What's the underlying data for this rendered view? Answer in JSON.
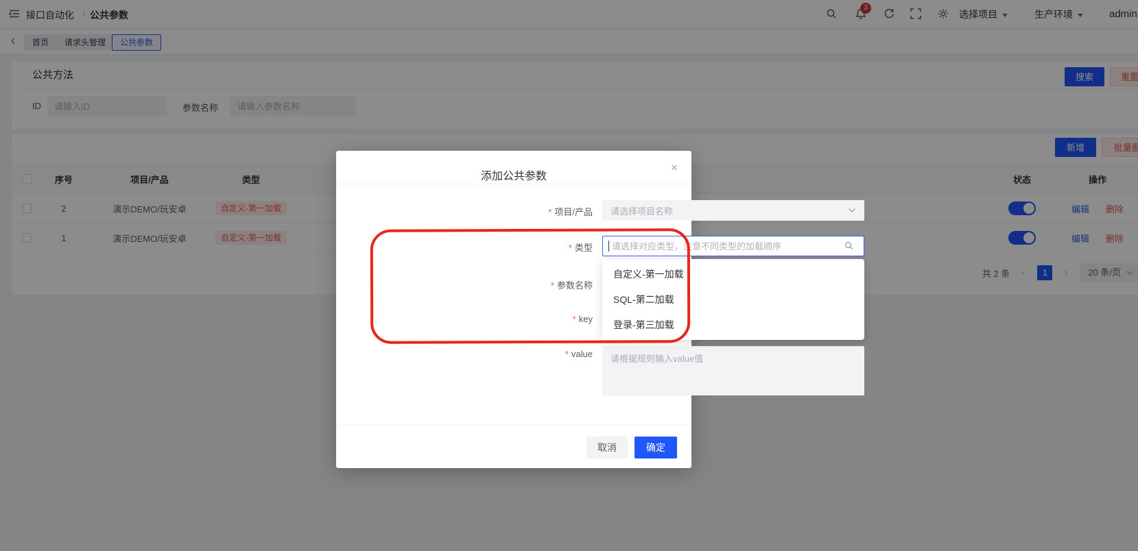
{
  "header": {
    "breadcrumb_root": "接口自动化",
    "breadcrumb_sep": "/",
    "breadcrumb_current": "公共参数",
    "notification_count": "3",
    "project_dropdown": "选择项目",
    "env_dropdown": "生产环境",
    "username": "admin"
  },
  "tabbar": {
    "back_icon": "‹",
    "tabs": [
      {
        "label": "首页"
      },
      {
        "label": "请求头管理"
      },
      {
        "label": "公共参数"
      }
    ]
  },
  "search_panel": {
    "title": "公共方法",
    "id_label": "ID",
    "id_placeholder": "请输入ID",
    "name_label": "参数名称",
    "name_placeholder": "请输入参数名称",
    "search_button": "搜索",
    "reset_button": "重置"
  },
  "toolbar": {
    "add_button": "新增",
    "batch_delete_button": "批量删除"
  },
  "table": {
    "columns": [
      "序号",
      "项目/产品",
      "类型",
      "状态",
      "操作"
    ],
    "rows": [
      {
        "seq": "2",
        "project": "演示DEMO/玩安卓",
        "type_tag": "自定义-第一加载",
        "status": "on",
        "edit": "编辑",
        "remove": "删除"
      },
      {
        "seq": "1",
        "project": "演示DEMO/玩安卓",
        "type_tag": "自定义-第一加载",
        "status": "on",
        "edit": "编辑",
        "remove": "删除"
      }
    ]
  },
  "pagination": {
    "total": "共 2 条",
    "prev_icon": "‹",
    "page": "1",
    "next_icon": "›",
    "page_size": "20 条/页"
  },
  "modal": {
    "title": "添加公共参数",
    "close_icon": "×",
    "required_mark": "*",
    "project_label": "项目/产品",
    "project_placeholder": "请选择项目名称",
    "type_label": "类型",
    "type_placeholder": "请选择对应类型，注意不同类型的加载顺序",
    "dropdown_options": [
      "自定义-第一加载",
      "SQL-第二加载",
      "登录-第三加载"
    ],
    "param_name_label": "参数名称",
    "key_label": "key",
    "value_label": "value",
    "value_placeholder": "请根据规则输入value值",
    "cancel_button": "取消",
    "ok_button": "确定"
  },
  "colors": {
    "primary": "#2057fa",
    "danger": "#e25656",
    "tag_bg": "#fdebeb",
    "annotation": "#e8271b",
    "mask": "rgba(0,0,0,0.45)"
  }
}
